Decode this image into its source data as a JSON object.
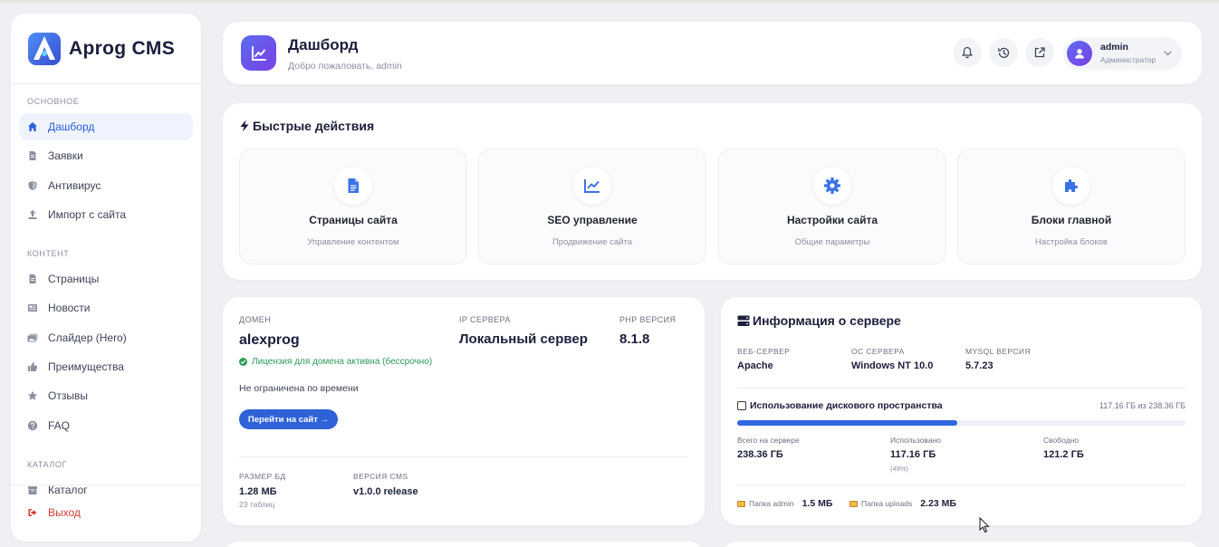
{
  "brand": {
    "name": "Aprog CMS"
  },
  "sidebar": {
    "sections": [
      {
        "title": "ОСНОВНОЕ"
      },
      {
        "title": "КОНТЕНТ"
      },
      {
        "title": "КАТАЛОГ"
      }
    ],
    "main_items": [
      {
        "label": "Дашборд",
        "icon": "home-icon",
        "active": true
      },
      {
        "label": "Заявки",
        "icon": "document-icon"
      },
      {
        "label": "Антивирус",
        "icon": "shield-icon"
      },
      {
        "label": "Импорт с сайта",
        "icon": "upload-icon"
      }
    ],
    "content_items": [
      {
        "label": "Страницы",
        "icon": "document-icon"
      },
      {
        "label": "Новости",
        "icon": "newspaper-icon"
      },
      {
        "label": "Слайдер (Hero)",
        "icon": "images-icon"
      },
      {
        "label": "Преимущества",
        "icon": "thumbs-up-icon"
      },
      {
        "label": "Отзывы",
        "icon": "star-icon"
      },
      {
        "label": "FAQ",
        "icon": "question-icon"
      }
    ],
    "catalog_items": [
      {
        "label": "Каталог",
        "icon": "box-icon"
      }
    ],
    "logout_label": "Выход"
  },
  "header": {
    "title": "Дашборд",
    "subtitle": "Добро пожаловать, admin",
    "user": {
      "name": "admin",
      "role": "Администратор"
    }
  },
  "quick": {
    "title": "Быстрые действия",
    "actions": [
      {
        "title": "Страницы сайта",
        "subtitle": "Управление контентом",
        "icon": "file-icon"
      },
      {
        "title": "SEO управление",
        "subtitle": "Продвижение сайта",
        "icon": "chart-line-icon"
      },
      {
        "title": "Настройки сайта",
        "subtitle": "Общие параметры",
        "icon": "gear-icon"
      },
      {
        "title": "Блоки главной",
        "subtitle": "Настройка блоков",
        "icon": "puzzle-icon"
      }
    ]
  },
  "domain": {
    "domain_label": "ДОМЕН",
    "domain_value": "alexprog",
    "ip_label": "IP СЕРВЕРА",
    "ip_value": "Локальный сервер",
    "php_label": "PHP ВЕРСИЯ",
    "php_value": "8.1.8",
    "license": "Лицензия для домена активна (бессрочно)",
    "note": "Не ограничена по времени",
    "go_button": "Перейти на сайт →",
    "db_label": "РАЗМЕР БД",
    "db_value": "1.28 МБ",
    "db_tables": "23 таблиц",
    "cms_label": "ВЕРСИЯ CMS",
    "cms_value": "v1.0.0 release"
  },
  "server": {
    "title": "Информация о сервере",
    "web_label": "ВЕБ-СЕРВЕР",
    "web_value": "Apache",
    "os_label": "ОС СЕРВЕРА",
    "os_value": "Windows NT 10.0",
    "mysql_label": "MYSQL ВЕРСИЯ",
    "mysql_value": "5.7.23",
    "disk_title": "Использование дискового пространства",
    "disk_total_text": "117.16 ГБ из 238.36 ГБ",
    "disk_used_fraction": 0.49,
    "total_label": "Всего на сервере",
    "total_value": "238.36 ГБ",
    "used_label": "Использовано",
    "used_value": "117.16 ГБ",
    "used_percent": "(49%)",
    "free_label": "Свободно",
    "free_value": "121.2 ГБ",
    "admin_folder_label": "Папка admin",
    "admin_folder_value": "1.5 МБ",
    "uploads_folder_label": "Папка uploads",
    "uploads_folder_value": "2.23 МБ"
  },
  "colors": {
    "accent": "#2e62d6",
    "success": "#2c9b55",
    "danger": "#d23a2e",
    "gradient_start": "#5b6cf0",
    "gradient_end": "#7b3fe4"
  }
}
